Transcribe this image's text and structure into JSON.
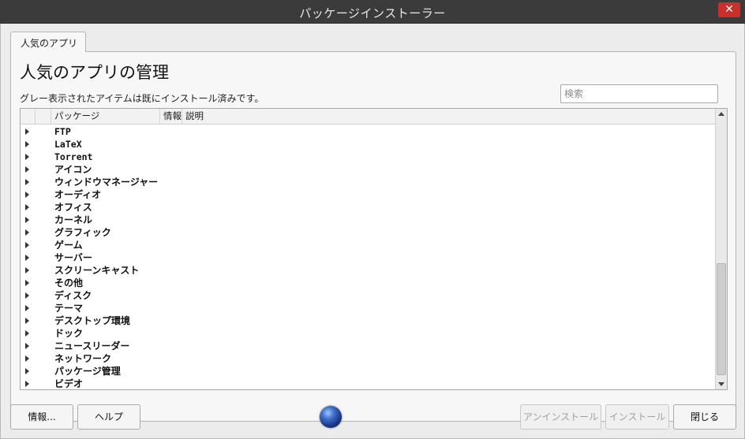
{
  "window": {
    "title": "パッケージインストーラー",
    "close_glyph": "✕"
  },
  "tab": {
    "label": "人気のアプリ"
  },
  "main": {
    "heading": "人気のアプリの管理",
    "subtext": "グレー表示されたアイテムは既にインストール済みです。",
    "search_placeholder": "検索"
  },
  "tree": {
    "columns": [
      "パッケージ",
      "情報",
      "説明"
    ],
    "rows": [
      "FTP",
      "LaTeX",
      "Torrent",
      "アイコン",
      "ウィンドウマネージャー",
      "オーディオ",
      "オフィス",
      "カーネル",
      "グラフィック",
      "ゲーム",
      "サーバー",
      "スクリーンキャスト",
      "その他",
      "ディスク",
      "テーマ",
      "デスクトップ環境",
      "ドック",
      "ニュースリーダー",
      "ネットワーク",
      "パッケージ管理",
      "ビデオ"
    ]
  },
  "buttons": {
    "info": "情報...",
    "help": "ヘルプ",
    "uninstall": "アンインストール",
    "install": "インストール",
    "close": "閉じる"
  },
  "icons": {
    "expand": "expand-arrow-icon",
    "logo": "globe-icon"
  }
}
